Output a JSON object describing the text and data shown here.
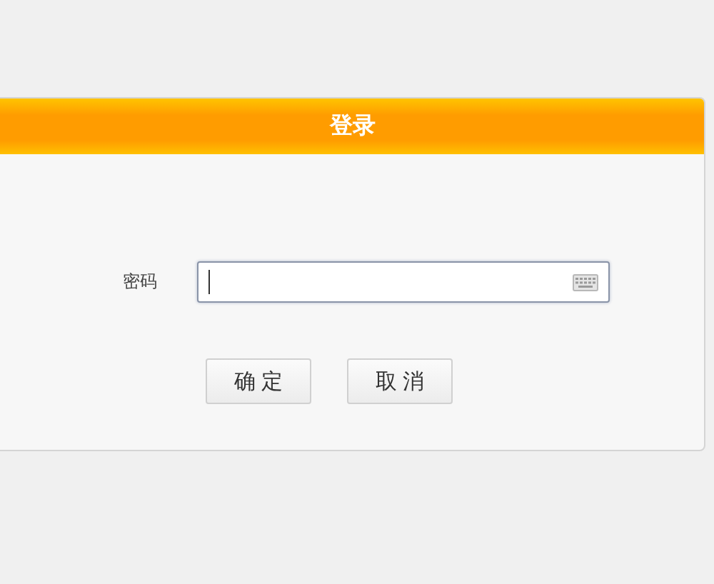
{
  "dialog": {
    "title": "登录",
    "password_field": {
      "label": "密码",
      "focused": true
    },
    "buttons": [
      {
        "label": "确定"
      },
      {
        "label": "取消"
      }
    ]
  }
}
